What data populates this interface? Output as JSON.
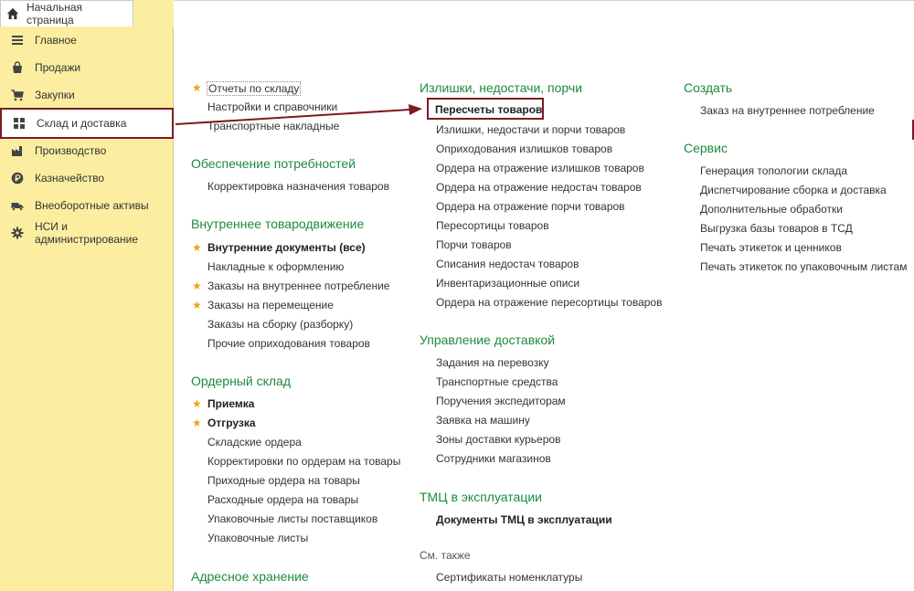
{
  "top_tab": {
    "label": "Начальная страница",
    "icon": "home-icon"
  },
  "sidebar": {
    "items": [
      {
        "label": "Главное",
        "icon": "menu-lines-icon"
      },
      {
        "label": "Продажи",
        "icon": "shopping-bag-icon"
      },
      {
        "label": "Закупки",
        "icon": "cart-icon"
      },
      {
        "label": "Склад и доставка",
        "icon": "warehouse-grid-icon",
        "active": true
      },
      {
        "label": "Производство",
        "icon": "factory-icon"
      },
      {
        "label": "Казначейство",
        "icon": "ruble-coin-icon"
      },
      {
        "label": "Внеоборотные активы",
        "icon": "truck-icon"
      },
      {
        "label": "НСИ и администрирование",
        "icon": "gear-icon"
      }
    ]
  },
  "col1": {
    "top_links": [
      "Отчеты по складу",
      "Настройки и справочники",
      "Транспортные накладные"
    ],
    "sec1_title": "Обеспечение потребностей",
    "sec1_links": [
      "Корректировка назначения товаров"
    ],
    "sec2_title": "Внутреннее товародвижение",
    "sec2_links": [
      "Внутренние документы (все)",
      "Накладные к оформлению",
      "Заказы на внутреннее потребление",
      "Заказы на перемещение",
      "Заказы на сборку (разборку)",
      "Прочие оприходования товаров"
    ],
    "sec3_title": "Ордерный склад",
    "sec3_links": [
      "Приемка",
      "Отгрузка",
      "Складские ордера",
      "Корректировки по ордерам на товары",
      "Приходные ордера на товары",
      "Расходные ордера на товары",
      "Упаковочные листы поставщиков",
      "Упаковочные листы"
    ],
    "sec4_title": "Адресное хранение"
  },
  "col2": {
    "sec1_title": "Излишки, недостачи, порчи",
    "sec1_links": [
      "Пересчеты товаров",
      "Излишки, недостачи и порчи товаров",
      "Оприходования излишков товаров",
      "Ордера на отражение излишков товаров",
      "Ордера на отражение недостач товаров",
      "Ордера на отражение порчи товаров",
      "Пересортицы товаров",
      "Порчи товаров",
      "Списания недостач товаров",
      "Инвентаризационные описи",
      "Ордера на отражение пересортицы товаров"
    ],
    "sec2_title": "Управление доставкой",
    "sec2_links": [
      "Задания на перевозку",
      "Транспортные средства",
      "Поручения экспедиторам",
      "Заявка на машину",
      "Зоны доставки курьеров",
      "Сотрудники магазинов"
    ],
    "sec3_title": "ТМЦ в эксплуатации",
    "sec3_links": [
      "Документы ТМЦ в эксплуатации"
    ],
    "see_also": "См. также",
    "see_also_links": [
      "Сертификаты номенклатуры"
    ]
  },
  "col3": {
    "sec1_title": "Создать",
    "sec1_links": [
      "Заказ на внутреннее потребление"
    ],
    "sec2_title": "Сервис",
    "sec2_links": [
      "Генерация топологии склада",
      "Диспетчирование сборка и доставка",
      "Дополнительные обработки",
      "Выгрузка базы товаров в ТСД",
      "Печать этикеток и ценников",
      "Печать этикеток по упаковочным листам"
    ]
  },
  "colors": {
    "sidebar_bg": "#fbeea0",
    "section_header": "#1e8a3c",
    "annotation": "#7d1b20",
    "star": "#f0a020"
  }
}
